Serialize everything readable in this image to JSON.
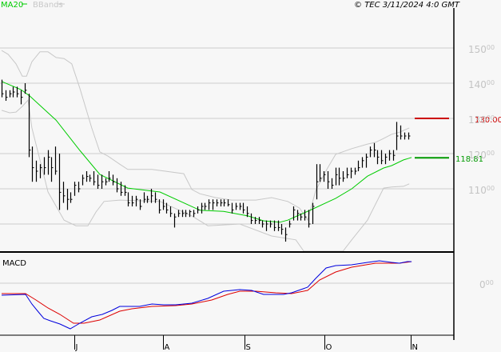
{
  "header": {
    "legend_ma": "MA20",
    "legend_bb": "BBands",
    "copyright": "© TEC 3/11/2024 4:0 GMT"
  },
  "colors": {
    "ma": "#00cc00",
    "bb": "#c8c8c8",
    "bar": "#000000",
    "resistance": "#cc0000",
    "support": "#009900",
    "macd": "#0000dd",
    "signal": "#dd0000",
    "grid": "#cccccc"
  },
  "chart_data": [
    {
      "type": "ohlc",
      "title": "Price",
      "ylim": [
        91,
        155
      ],
      "y_ticks": [
        {
          "int": "150",
          "dec": "00"
        },
        {
          "int": "140",
          "dec": "00"
        },
        {
          "int": "130",
          "dec": "00"
        },
        {
          "int": "120",
          "dec": "00"
        },
        {
          "int": "110",
          "dec": "00"
        }
      ],
      "y_tick_values": [
        150,
        140,
        130,
        120,
        110,
        100
      ],
      "x_months": [
        {
          "label": "J",
          "bar": 19
        },
        {
          "label": "A",
          "bar": 42
        },
        {
          "label": "S",
          "bar": 63.3
        },
        {
          "label": "O",
          "bar": 84.2
        },
        {
          "label": "N",
          "bar": 106.7
        }
      ],
      "bars_hlc": [
        [
          141,
          136,
          137
        ],
        [
          138,
          135,
          136
        ],
        [
          138,
          136,
          137
        ],
        [
          139,
          136,
          137.5
        ],
        [
          139,
          136,
          137
        ],
        [
          138,
          134,
          136
        ],
        [
          140,
          137,
          138
        ],
        [
          137,
          119,
          121
        ],
        [
          122,
          112,
          116
        ],
        [
          118,
          112,
          115
        ],
        [
          117,
          113,
          116
        ],
        [
          119,
          114,
          116
        ],
        [
          121,
          114,
          119
        ],
        [
          119,
          112,
          116
        ],
        [
          122,
          114,
          115
        ],
        [
          120,
          104,
          109
        ],
        [
          112,
          106,
          108
        ],
        [
          110,
          104,
          107
        ],
        [
          109,
          106,
          107
        ],
        [
          112,
          108,
          111
        ],
        [
          112,
          109,
          110
        ],
        [
          114,
          111,
          113
        ],
        [
          115,
          112,
          113.5
        ],
        [
          114,
          112,
          113
        ],
        [
          115,
          111,
          112
        ],
        [
          114,
          110,
          111
        ],
        [
          114,
          110,
          112
        ],
        [
          113,
          111,
          112
        ],
        [
          115,
          112,
          113
        ],
        [
          114,
          111,
          112
        ],
        [
          113,
          109,
          110
        ],
        [
          112,
          108,
          109
        ],
        [
          111,
          108,
          109
        ],
        [
          109,
          105,
          106
        ],
        [
          108,
          105,
          106
        ],
        [
          108,
          105,
          107
        ],
        [
          107,
          104,
          105
        ],
        [
          109,
          106,
          107
        ],
        [
          108,
          106,
          107
        ],
        [
          110,
          106,
          108
        ],
        [
          109,
          106,
          107
        ],
        [
          107,
          103,
          104
        ],
        [
          107,
          104,
          105
        ],
        [
          106,
          103,
          104
        ],
        [
          105,
          102,
          103
        ],
        [
          103,
          99,
          102
        ],
        [
          104,
          102,
          103
        ],
        [
          104,
          102,
          103
        ],
        [
          104,
          102,
          103
        ],
        [
          104,
          102,
          103.5
        ],
        [
          104,
          102,
          103
        ],
        [
          105,
          103,
          104
        ],
        [
          106,
          103,
          105
        ],
        [
          106,
          104,
          105
        ],
        [
          107,
          104,
          106
        ],
        [
          107,
          104,
          106
        ],
        [
          107,
          105,
          106
        ],
        [
          107,
          105,
          106
        ],
        [
          107,
          105,
          106
        ],
        [
          107,
          105,
          105.5
        ],
        [
          106,
          103,
          104
        ],
        [
          106,
          104,
          105
        ],
        [
          106,
          104,
          105
        ],
        [
          106,
          103,
          104
        ],
        [
          105,
          102,
          103
        ],
        [
          103,
          100,
          101
        ],
        [
          102,
          100,
          101
        ],
        [
          102,
          100,
          101
        ],
        [
          101,
          99,
          100
        ],
        [
          101,
          98,
          100
        ],
        [
          101,
          99,
          100
        ],
        [
          101,
          98,
          99
        ],
        [
          101,
          98,
          99
        ],
        [
          100,
          97,
          98.5
        ],
        [
          99,
          95,
          97
        ],
        [
          101,
          99,
          100
        ],
        [
          105,
          101,
          104
        ],
        [
          104,
          101,
          103
        ],
        [
          103,
          101,
          102
        ],
        [
          104,
          101,
          102
        ],
        [
          104,
          99,
          100
        ],
        [
          106,
          100,
          105
        ],
        [
          117,
          107,
          112
        ],
        [
          117,
          112,
          113
        ],
        [
          115,
          112,
          114
        ],
        [
          115,
          110,
          112
        ],
        [
          113,
          110,
          111
        ],
        [
          116,
          111,
          114
        ],
        [
          116,
          111,
          113
        ],
        [
          115,
          112,
          113
        ],
        [
          116,
          113,
          114
        ],
        [
          116,
          113,
          115
        ],
        [
          116,
          114,
          115
        ],
        [
          118,
          115,
          116
        ],
        [
          119,
          116,
          118
        ],
        [
          120,
          116,
          119
        ],
        [
          122,
          119,
          121
        ],
        [
          123,
          119,
          121
        ],
        [
          121,
          117,
          119
        ],
        [
          121,
          117,
          118
        ],
        [
          120,
          117,
          119
        ],
        [
          121,
          118,
          120
        ],
        [
          121,
          118,
          119.5
        ],
        [
          129,
          121,
          125
        ],
        [
          128,
          124,
          125
        ],
        [
          126,
          124,
          125
        ],
        [
          126,
          124,
          125
        ]
      ],
      "ma20": [
        [
          0,
          140.5
        ],
        [
          5,
          138.2
        ],
        [
          7.3,
          136.4
        ],
        [
          14.2,
          129.5
        ],
        [
          20.4,
          120.9
        ],
        [
          25.6,
          114.1
        ],
        [
          32.9,
          110.2
        ],
        [
          41.3,
          109.1
        ],
        [
          51.7,
          103.9
        ],
        [
          57.9,
          103.6
        ],
        [
          64.2,
          102.3
        ],
        [
          68.3,
          100.9
        ],
        [
          72.5,
          100.5
        ],
        [
          74.6,
          101.1
        ],
        [
          80.8,
          104.1
        ],
        [
          87.1,
          107.3
        ],
        [
          91.3,
          110
        ],
        [
          95.4,
          113.6
        ],
        [
          99.6,
          115.9
        ],
        [
          101.7,
          116.6
        ],
        [
          104.8,
          118.2
        ],
        [
          106.9,
          118.9
        ]
      ],
      "bb_upper": [
        [
          0,
          149.3
        ],
        [
          1.7,
          148.2
        ],
        [
          3.75,
          145.5
        ],
        [
          5.4,
          142
        ],
        [
          6.5,
          142
        ],
        [
          7.9,
          146.1
        ],
        [
          10,
          148.9
        ],
        [
          12.1,
          148.9
        ],
        [
          14.2,
          147.3
        ],
        [
          16.3,
          147
        ],
        [
          18.3,
          145.5
        ],
        [
          20.4,
          138.6
        ],
        [
          23.5,
          127.3
        ],
        [
          25.6,
          120.5
        ],
        [
          27.7,
          119.3
        ],
        [
          30.8,
          117
        ],
        [
          32.9,
          115.5
        ],
        [
          39.2,
          115.5
        ],
        [
          47.5,
          114.3
        ],
        [
          49.6,
          109.8
        ],
        [
          51.7,
          108.6
        ],
        [
          55.8,
          107.5
        ],
        [
          60,
          106.8
        ],
        [
          66.3,
          106.8
        ],
        [
          70.4,
          107.5
        ],
        [
          74.6,
          106.4
        ],
        [
          77.7,
          104.5
        ],
        [
          79.8,
          101.1
        ],
        [
          81.9,
          109.5
        ],
        [
          85,
          115.9
        ],
        [
          87.1,
          119.8
        ],
        [
          91.3,
          121.4
        ],
        [
          95.4,
          122.7
        ],
        [
          97.5,
          123.2
        ],
        [
          99.6,
          124.3
        ],
        [
          101.7,
          125.5
        ],
        [
          103.8,
          126.1
        ],
        [
          106.3,
          127.3
        ]
      ],
      "bb_lower": [
        [
          0,
          132.3
        ],
        [
          2.1,
          131.6
        ],
        [
          3.75,
          131.8
        ],
        [
          5.4,
          133.4
        ],
        [
          6.9,
          135.2
        ],
        [
          7.9,
          127.3
        ],
        [
          10,
          118.2
        ],
        [
          12.1,
          109.1
        ],
        [
          16.3,
          101.1
        ],
        [
          19.4,
          99.5
        ],
        [
          22.5,
          99.5
        ],
        [
          24.6,
          103.4
        ],
        [
          26.7,
          106.4
        ],
        [
          30.8,
          106.8
        ],
        [
          41.3,
          106.4
        ],
        [
          49.6,
          102.3
        ],
        [
          53.8,
          99.5
        ],
        [
          62.1,
          100
        ],
        [
          70.4,
          96.6
        ],
        [
          76.7,
          95.5
        ],
        [
          78.8,
          91.4
        ],
        [
          89,
          91.4
        ],
        [
          91.3,
          95.5
        ],
        [
          95.4,
          101.1
        ],
        [
          99.6,
          110.2
        ],
        [
          101.7,
          110.5
        ],
        [
          104.8,
          110.7
        ],
        [
          106.3,
          111.4
        ]
      ],
      "levels": [
        {
          "name": "resistance",
          "value": 130.0,
          "label": "130.00"
        },
        {
          "name": "support",
          "value": 118.81,
          "label": "118.81"
        }
      ]
    },
    {
      "type": "line",
      "title": "MACD",
      "ylim": [
        -6.5,
        3.5
      ],
      "zero_label": {
        "int": "0",
        "dec": "00"
      },
      "series": [
        {
          "name": "MACD",
          "points": [
            [
              0,
              -1.5
            ],
            [
              6.25,
              -1.4
            ],
            [
              7.9,
              -2.6
            ],
            [
              9.6,
              -3.6
            ],
            [
              11,
              -4.4
            ],
            [
              12.7,
              -4.7
            ],
            [
              15.2,
              -5.1
            ],
            [
              17.9,
              -5.7
            ],
            [
              20.4,
              -5.0
            ],
            [
              23.5,
              -4.2
            ],
            [
              26.25,
              -3.9
            ],
            [
              28.75,
              -3.4
            ],
            [
              30.8,
              -2.9
            ],
            [
              32.9,
              -2.9
            ],
            [
              36,
              -2.9
            ],
            [
              39.2,
              -2.6
            ],
            [
              42.3,
              -2.7
            ],
            [
              45.4,
              -2.7
            ],
            [
              49.6,
              -2.5
            ],
            [
              53.75,
              -1.9
            ],
            [
              57.9,
              -1.0
            ],
            [
              62.1,
              -0.8
            ],
            [
              65.2,
              -0.9
            ],
            [
              68.3,
              -1.4
            ],
            [
              73.5,
              -1.4
            ],
            [
              75.6,
              -1.2
            ],
            [
              79.8,
              -0.5
            ],
            [
              81.9,
              0.6
            ],
            [
              84.6,
              1.9
            ],
            [
              87.1,
              2.2
            ],
            [
              91.25,
              2.3
            ],
            [
              95.4,
              2.6
            ],
            [
              98.5,
              2.8
            ],
            [
              101.7,
              2.6
            ],
            [
              103.75,
              2.5
            ],
            [
              105.8,
              2.7
            ],
            [
              106.9,
              2.7
            ]
          ]
        },
        {
          "name": "Signal",
          "points": [
            [
              0,
              -1.3
            ],
            [
              6.25,
              -1.3
            ],
            [
              8.96,
              -2.1
            ],
            [
              12.1,
              -3.1
            ],
            [
              15.2,
              -3.9
            ],
            [
              18.75,
              -5.0
            ],
            [
              21.5,
              -5.0
            ],
            [
              25.6,
              -4.6
            ],
            [
              30.8,
              -3.5
            ],
            [
              33.96,
              -3.2
            ],
            [
              39.2,
              -2.9
            ],
            [
              45.4,
              -2.8
            ],
            [
              49.6,
              -2.6
            ],
            [
              54.8,
              -2.1
            ],
            [
              58.96,
              -1.4
            ],
            [
              62.1,
              -1.0
            ],
            [
              66.25,
              -1.0
            ],
            [
              71.5,
              -1.2
            ],
            [
              75.6,
              -1.3
            ],
            [
              79.8,
              -0.9
            ],
            [
              82.9,
              0.4
            ],
            [
              87.1,
              1.4
            ],
            [
              91.25,
              2.0
            ],
            [
              97.5,
              2.5
            ],
            [
              103.75,
              2.5
            ],
            [
              106.9,
              2.7
            ]
          ]
        }
      ]
    }
  ]
}
